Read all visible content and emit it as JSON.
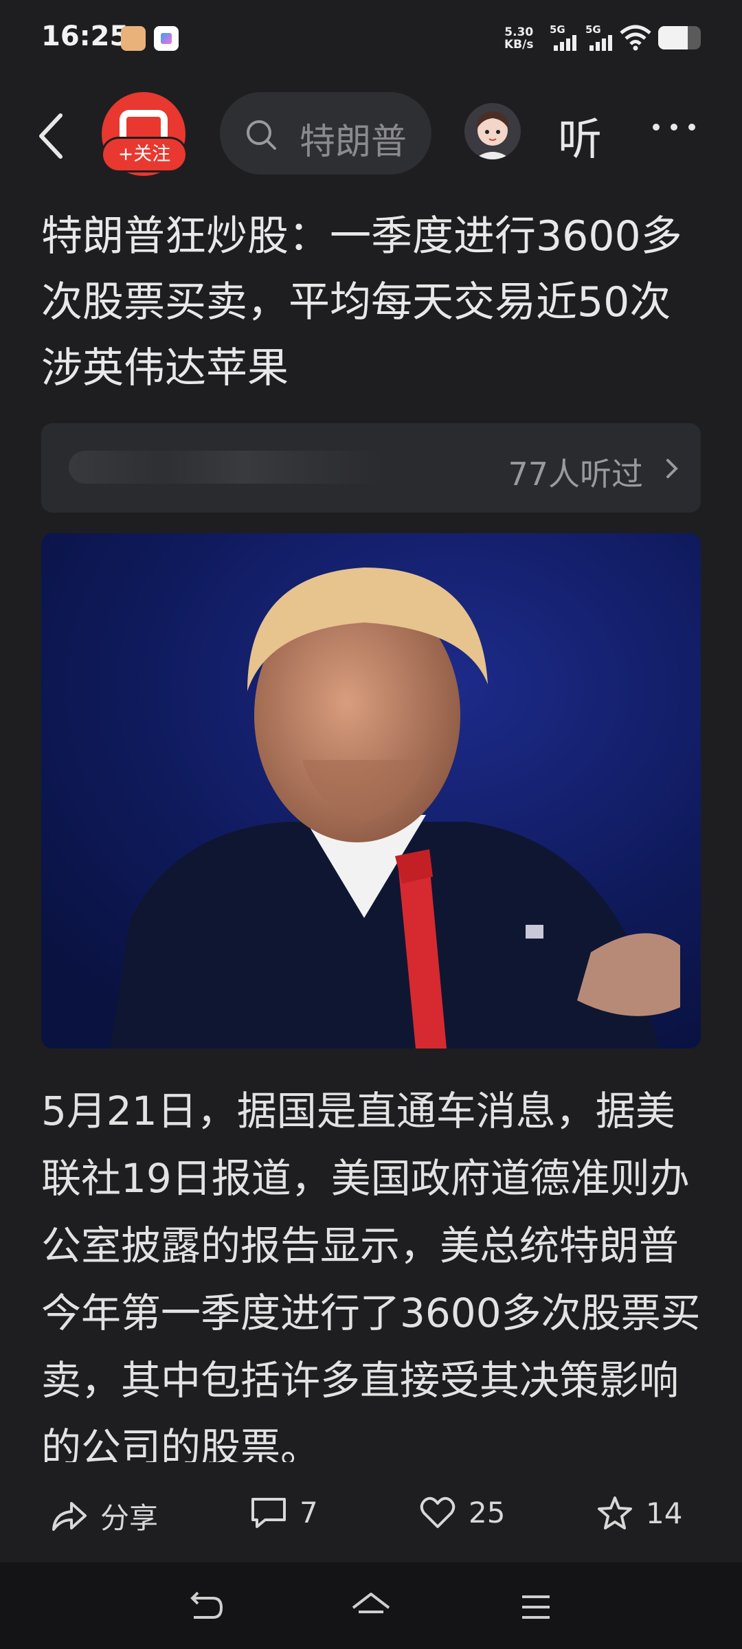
{
  "status_bar": {
    "time": "16:25",
    "net_speed_value": "5.30",
    "net_speed_unit": "KB/s",
    "signal1_label": "5G",
    "signal2_label": "5G",
    "battery_level": 0.7
  },
  "top_bar": {
    "follow_label": "+关注",
    "search_placeholder": "特朗普",
    "listen_label": "听"
  },
  "article": {
    "title": "特朗普狂炒股：一季度进行3600多次股票买卖，平均每天交易近50次  涉英伟达苹果",
    "listen_count": "77人听过",
    "body": "5月21日，据国是直通车消息，据美联社19日报道，美国政府道德准则办公室披露的报告显示，美总统特朗普今年第一季度进行了3600多次股票买卖，其中包括许多直接受其决策影响的公司的股票。"
  },
  "actions": {
    "share_label": "分享",
    "comment_count": "7",
    "like_count": "25",
    "favorite_count": "14"
  },
  "colors": {
    "background": "#1e1e20",
    "accent_red": "#e8382f",
    "text_primary": "#e6e6e6",
    "text_secondary": "#9a9a9e"
  },
  "icons": [
    "back-icon",
    "search-icon",
    "more-icon",
    "share-icon",
    "comment-icon",
    "heart-icon",
    "star-icon",
    "nav-back-icon",
    "nav-home-icon",
    "nav-menu-icon"
  ]
}
